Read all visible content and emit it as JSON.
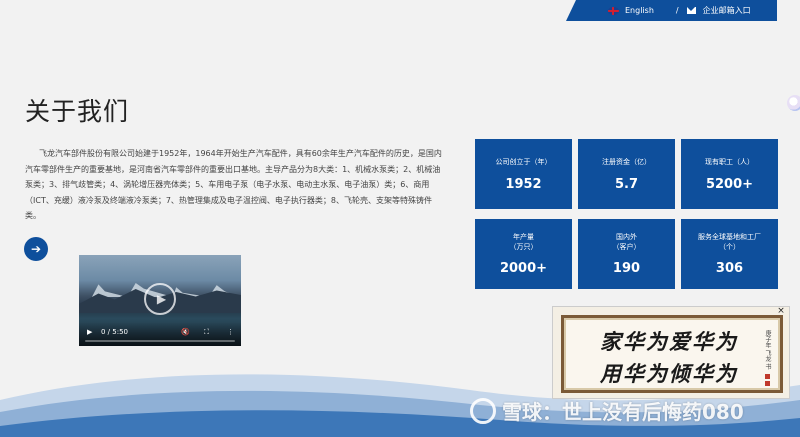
{
  "topbar": {
    "language": "English",
    "separator": "/",
    "mail_entry": "企业邮箱入口"
  },
  "about": {
    "title": "关于我们",
    "description": "飞龙汽车部件股份有限公司始建于1952年，1964年开始生产汽车配件，具有60余年生产汽车配件的历史，是国内汽车零部件生产的重要基地，是河南省汽车零部件的重要出口基地。主导产品分为8大类：1、机械水泵类；2、机械油泵类；3、排气歧管类；4、涡轮增压器壳体类；5、车用电子泵（电子水泵、电动主水泵、电子油泵）类；6、商用（ICT、充缓）液冷泵及终端液冷泵类；7、热管理集成及电子温控阀、电子执行器类；8、飞轮壳、支架等特殊铸件类。",
    "more_icon": "arrow-right-icon"
  },
  "video": {
    "time": "0 / 5:50",
    "progress": 0
  },
  "stats": [
    {
      "label": "公司创立于（年）",
      "value": "1952"
    },
    {
      "label": "注册资金（亿）",
      "value": "5.7"
    },
    {
      "label": "现有职工（人）",
      "value": "5200+"
    },
    {
      "label": "年产量\n（万只）",
      "value": "2000+"
    },
    {
      "label": "国内外\n（客户）",
      "value": "190"
    },
    {
      "label": "服务全球基地和工厂\n（个）",
      "value": "306"
    }
  ],
  "popup": {
    "line1": "家华为爱华为",
    "line2": "用华为倾华为",
    "close": "×"
  },
  "watermark": "雪球：世上没有后悔药080",
  "colors": {
    "brand_blue": "#0e4f9c",
    "background": "#f2f2f2"
  }
}
